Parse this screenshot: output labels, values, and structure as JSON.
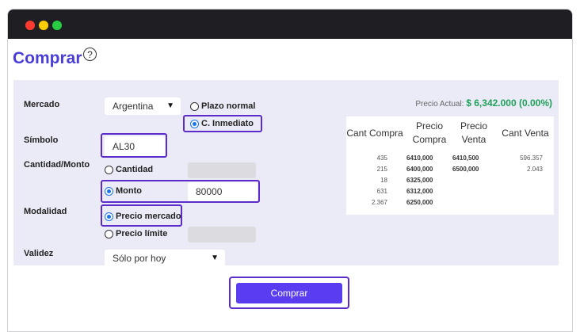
{
  "page": {
    "title": "Comprar",
    "help_icon": "?"
  },
  "form": {
    "mercado": {
      "label": "Mercado",
      "value": "Argentina",
      "options_right": [
        "Plazo normal",
        "C. Inmediato"
      ]
    },
    "simbolo": {
      "label": "Símbolo",
      "value": "AL30"
    },
    "cantidad_monto": {
      "label": "Cantidad/Monto",
      "opt_cantidad": "Cantidad",
      "opt_monto": "Monto",
      "monto_value": "80000"
    },
    "modalidad": {
      "label": "Modalidad",
      "opt_mercado": "Precio mercado",
      "opt_limite": "Precio límite"
    },
    "validez": {
      "label": "Validez",
      "value": "Sólo por hoy"
    }
  },
  "price": {
    "label": "Precio Actual:",
    "value": "$ 6,342.000 (0.00%)"
  },
  "book": {
    "headers": [
      "Cant Compra",
      "Precio Compra",
      "Precio Venta",
      "Cant Venta"
    ],
    "rows": [
      [
        "435",
        "6410,000",
        "6410,500",
        "596.357"
      ],
      [
        "215",
        "6400,000",
        "6500,000",
        "2.043"
      ],
      [
        "18",
        "6325,000",
        "",
        ""
      ],
      [
        "631",
        "6312,000",
        "",
        ""
      ],
      [
        "2.367",
        "6250,000",
        "",
        ""
      ]
    ]
  },
  "actions": {
    "buy_label": "Comprar"
  },
  "colors": {
    "accent": "#4a3ed6",
    "button": "#5a3df0",
    "highlight": "#5b2cc9",
    "price_up": "#1fa05a"
  }
}
